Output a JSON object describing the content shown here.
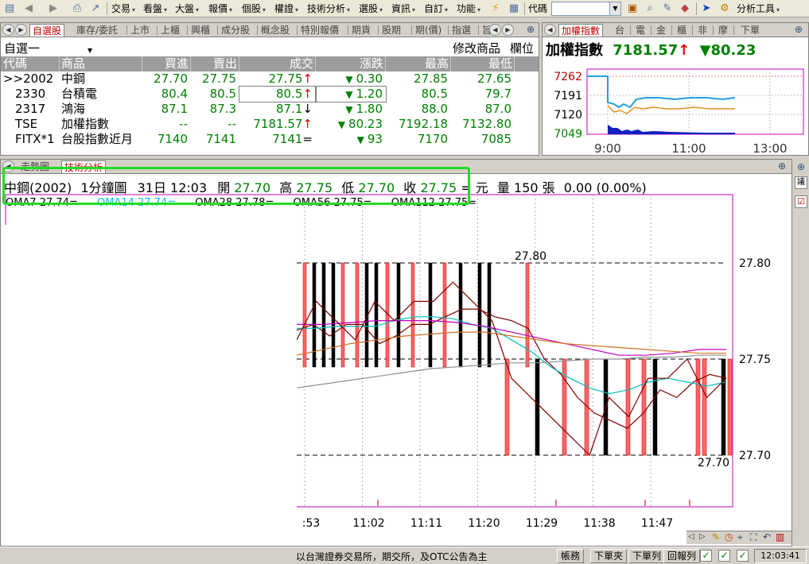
{
  "menubar": {
    "items": [
      {
        "label": "交易"
      },
      {
        "label": "看盤"
      },
      {
        "label": "大盤"
      },
      {
        "label": "報價"
      },
      {
        "label": "個股"
      },
      {
        "label": "權證"
      },
      {
        "label": "技術分析"
      },
      {
        "label": "選股"
      },
      {
        "label": "資訊"
      },
      {
        "label": "自訂"
      },
      {
        "label": "功能"
      }
    ],
    "code_label": "代碼",
    "code_value": "",
    "analysis_tools": "分析工具"
  },
  "watch_tabs": [
    "自選股",
    "庫存/委託",
    "上市",
    "上櫃",
    "興櫃",
    "成分股",
    "概念股",
    "特別報價",
    "期貨",
    "股期",
    "期(價)",
    "指選",
    "旨"
  ],
  "watchlist": {
    "group": "自選一",
    "edit_label": "修改商品",
    "cols_label": "欄位",
    "columns": [
      "代碼",
      "商品",
      "買進",
      "賣出",
      "成交",
      "漲跌",
      "最高",
      "最低"
    ],
    "rows": [
      {
        "code": ">>2002",
        "name": "中鋼",
        "bid": "27.70",
        "ask": "27.75",
        "last": "27.75",
        "last_dir": "up",
        "chg": "0.30",
        "chg_dir": "down",
        "high": "27.85",
        "low": "27.65"
      },
      {
        "code": "2330",
        "name": "台積電",
        "bid": "80.4",
        "ask": "80.5",
        "last": "80.5",
        "last_dir": "up",
        "chg": "1.20",
        "chg_dir": "down",
        "high": "80.5",
        "low": "79.7"
      },
      {
        "code": "2317",
        "name": "鴻海",
        "bid": "87.1",
        "ask": "87.3",
        "last": "87.1",
        "last_dir": "down",
        "chg": "1.80",
        "chg_dir": "down",
        "high": "88.0",
        "low": "87.0"
      },
      {
        "code": "TSE",
        "name": "加權指數",
        "bid": "--",
        "ask": "--",
        "last": "7181.57",
        "last_dir": "up",
        "chg": "80.23",
        "chg_dir": "down",
        "high": "7192.18",
        "low": "7132.80"
      },
      {
        "code": "FITX*1",
        "name": "台股指數近月",
        "bid": "7140",
        "ask": "7141",
        "last": "7141",
        "last_dir": "flat",
        "chg": "93",
        "chg_dir": "down",
        "high": "7170",
        "low": "7085"
      }
    ]
  },
  "index_tabs": [
    "加權指數",
    "台",
    "電",
    "金",
    "櫃",
    "非",
    "摩",
    "下單"
  ],
  "index_panel": {
    "name": "加權指數",
    "value": "7181.57",
    "change": "80.23",
    "y_labels": [
      "7262",
      "7191",
      "7120",
      "7049"
    ],
    "x_labels": [
      "9:00",
      "11:00",
      "13:00"
    ]
  },
  "chart_tabs": [
    "走勢圖",
    "技術分析"
  ],
  "chart_info": {
    "symbol": "中鋼(2002)",
    "period": "1分鐘圖",
    "date": "31日 12:03",
    "open_label": "開",
    "open": "27.70",
    "high_label": "高",
    "high": "27.75",
    "low_label": "低",
    "low": "27.70",
    "close_label": "收",
    "close": "27.75",
    "unit": "= 元",
    "vol_label": "量",
    "vol": "150",
    "vol_unit": "張",
    "change": "0.00 (0.00%)"
  },
  "ma_legend": [
    {
      "label": "OMA7 27.74=",
      "color": "#000000"
    },
    {
      "label": "OMA14 27.74=",
      "color": "#00c0ff"
    },
    {
      "label": "OMA28 27.78=",
      "color": "#000000"
    },
    {
      "label": "OMA56 27.75=",
      "color": "#000000"
    },
    {
      "label": "OMA112 27.75=",
      "color": "#000000"
    }
  ],
  "chart_data": {
    "type": "bar",
    "title": "中鋼(2002) 1分鐘圖",
    "y_ticks": [
      "27.80",
      "27.75",
      "27.70"
    ],
    "x_ticks": [
      ":53",
      "11:02",
      "11:11",
      "11:20",
      "11:29",
      "11:38",
      "11:47"
    ],
    "annotations": {
      "max_label": "27.80",
      "min_label": "27.70"
    },
    "ylim": [
      27.7,
      27.8
    ],
    "colors": {
      "up": "#ff6666",
      "down": "#000000",
      "ma_fast": "#00c0c0",
      "ma_med": "#c000c0",
      "ma_slow": "#d07020",
      "ma_long": "#909090",
      "line": "#800000"
    },
    "series": [
      {
        "name": "OMA7",
        "values": [
          27.765,
          27.768,
          27.762,
          27.768,
          27.768,
          27.758,
          27.762,
          27.768,
          27.768,
          27.772,
          27.776,
          27.776,
          27.772,
          27.77,
          27.766,
          27.75,
          27.742,
          27.73,
          27.722,
          27.718,
          27.714,
          27.722,
          27.734,
          27.73,
          27.738,
          27.742,
          27.74
        ]
      },
      {
        "name": "OMA14",
        "values": [
          27.766,
          27.766,
          27.767,
          27.767,
          27.767,
          27.77,
          27.772,
          27.772,
          27.771,
          27.768,
          27.766,
          27.76,
          27.754,
          27.746,
          27.74,
          27.735,
          27.732,
          27.734,
          27.738,
          27.74,
          27.738,
          27.736,
          27.738
        ]
      },
      {
        "name": "OMA28",
        "values": [
          27.768,
          27.768,
          27.769,
          27.77,
          27.77,
          27.77,
          27.769,
          27.767,
          27.764,
          27.761,
          27.758,
          27.755,
          27.752,
          27.752,
          27.753,
          27.755,
          27.755
        ]
      },
      {
        "name": "OMA56",
        "values": [
          27.752,
          27.755,
          27.758,
          27.76,
          27.762,
          27.763,
          27.764,
          27.764,
          27.762,
          27.76,
          27.758,
          27.757,
          27.756,
          27.755,
          27.754,
          27.753,
          27.753
        ]
      },
      {
        "name": "OMA112",
        "values": [
          27.735,
          27.737,
          27.739,
          27.741,
          27.743,
          27.745,
          27.746,
          27.747,
          27.748,
          27.748,
          27.749,
          27.75,
          27.75,
          27.751,
          27.751,
          27.752,
          27.752
        ]
      },
      {
        "name": "price",
        "values": [
          27.76,
          27.78,
          27.77,
          27.76,
          27.78,
          27.77,
          27.78,
          27.78,
          27.79,
          27.78,
          27.77,
          27.74,
          27.73,
          27.72,
          27.71,
          27.7,
          27.73,
          27.72,
          27.74,
          27.74,
          27.75,
          27.73,
          27.74
        ]
      }
    ],
    "bars": [
      {
        "t": 0,
        "c": "down"
      },
      {
        "t": 1,
        "c": "down"
      },
      {
        "t": 2,
        "c": "down"
      },
      {
        "t": 3,
        "c": "down"
      },
      {
        "t": 4,
        "c": "up"
      },
      {
        "t": 5,
        "c": "down"
      },
      {
        "t": 6,
        "c": "up"
      },
      {
        "t": 7,
        "c": "down"
      },
      {
        "t": 8,
        "c": "down"
      },
      {
        "t": 9,
        "c": "up"
      },
      {
        "t": 10,
        "c": "down"
      },
      {
        "t": 11,
        "c": "down"
      },
      {
        "t": 12,
        "c": "down"
      },
      {
        "t": 13,
        "c": "up"
      },
      {
        "t": 14,
        "c": "up"
      },
      {
        "t": 15,
        "c": "down"
      },
      {
        "t": 16,
        "c": "down"
      },
      {
        "t": 17,
        "c": "down"
      },
      {
        "t": 18,
        "c": "down"
      },
      {
        "t": 19,
        "c": "down"
      }
    ]
  },
  "status": {
    "ticker": "以台灣證券交易所，期交所，及OTC公告為主",
    "buttons": [
      "帳務",
      "下單夾",
      "下單列",
      "回報列"
    ],
    "clock": "12:03:41"
  }
}
